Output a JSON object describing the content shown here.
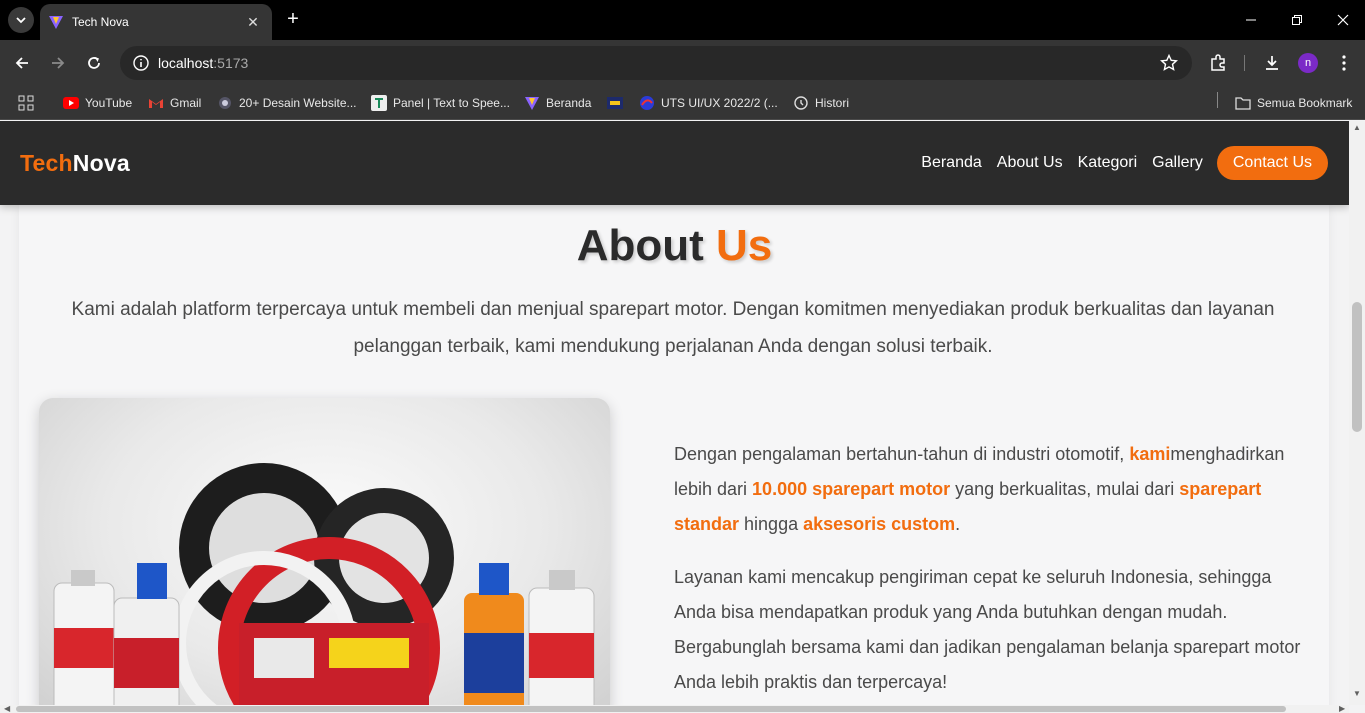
{
  "browser": {
    "tab_title": "Tech Nova",
    "url_host": "localhost",
    "url_port": ":5173",
    "profile_initial": "n",
    "bookmarks": [
      {
        "label": "YouTube",
        "icon": "youtube-icon"
      },
      {
        "label": "Gmail",
        "icon": "gmail-icon"
      },
      {
        "label": "20+ Desain Website...",
        "icon": "site-icon"
      },
      {
        "label": "Panel | Text to Spee...",
        "icon": "t-icon"
      },
      {
        "label": "Beranda",
        "icon": "vite-icon"
      },
      {
        "label": "",
        "icon": "flag-icon"
      },
      {
        "label": "UTS UI/UX 2022/2 (...",
        "icon": "edge-icon"
      },
      {
        "label": "Histori",
        "icon": "history-icon"
      }
    ],
    "all_bookmarks": "Semua Bookmark"
  },
  "site": {
    "brand_part1": "Tech",
    "brand_part2": "Nova",
    "nav": {
      "home": "Beranda",
      "about": "About Us",
      "category": "Kategori",
      "gallery": "Gallery",
      "contact": "Contact Us"
    }
  },
  "about": {
    "title_part1": "About ",
    "title_part2": "Us",
    "intro": "Kami adalah platform terpercaya untuk membeli dan menjual sparepart motor. Dengan komitmen menyediakan produk berkualitas dan layanan pelanggan terbaik, kami mendukung perjalanan Anda dengan solusi terbaik.",
    "p1_a": "Dengan pengalaman bertahun-tahun di industri otomotif, ",
    "p1_hl1": "kami",
    "p1_b": "menghadirkan lebih dari ",
    "p1_hl2": "10.000 sparepart motor",
    "p1_c": " yang berkualitas, mulai dari ",
    "p1_hl3": "sparepart standar",
    "p1_d": " hingga ",
    "p1_hl4": "aksesoris custom",
    "p1_e": ".",
    "p2": "Layanan kami mencakup pengiriman cepat ke seluruh Indonesia, sehingga Anda bisa mendapatkan produk yang Anda butuhkan dengan mudah. Bergabunglah bersama kami dan jadikan pengalaman belanja sparepart motor Anda lebih praktis dan terpercaya!"
  },
  "colors": {
    "accent": "#f26d0f",
    "nav_bg": "#2b2b2b",
    "text": "#4a4a4a"
  }
}
